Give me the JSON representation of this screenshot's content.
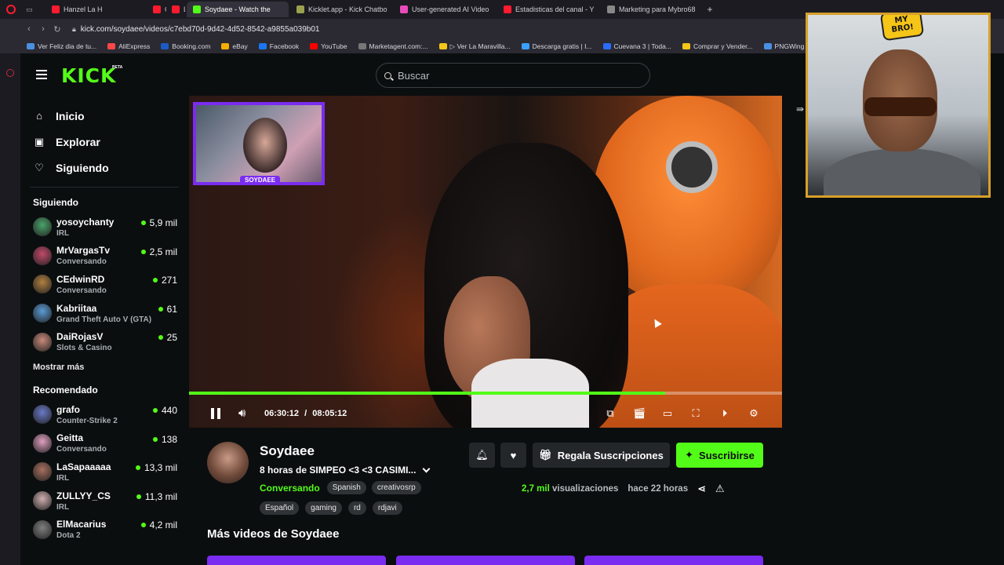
{
  "browser": {
    "tabs": [
      {
        "label": "Hanzel La H",
        "color": "#ff1b2d",
        "small": false
      },
      {
        "label": "Ovi",
        "color": "#ff1b2d",
        "small": true
      },
      {
        "label": "Lu",
        "color": "#ff1b2d",
        "small": true
      },
      {
        "label": "Soydaee - Watch the",
        "color": "#53fc18",
        "small": false,
        "active": true
      },
      {
        "label": "Kicklet.app - Kick Chatbo",
        "color": "#9aa14d",
        "small": false
      },
      {
        "label": "User-generated AI Video",
        "color": "#e74bb8",
        "small": false
      },
      {
        "label": "Estadisticas del canal - Y",
        "color": "#ff1b2d",
        "small": false
      },
      {
        "label": "Marketing para Mybro68",
        "color": "#888888",
        "small": false
      }
    ],
    "new_tab": "+",
    "url": "kick.com/soydaee/videos/c7ebd70d-9d42-4d52-8542-a9855a039b01",
    "bookmarks": [
      {
        "label": "Ver Feliz dia de tu...",
        "color": "#4a90e2"
      },
      {
        "label": "AliExpress",
        "color": "#ff4747"
      },
      {
        "label": "Booking.com",
        "color": "#1b5bc4"
      },
      {
        "label": "eBay",
        "color": "#f5af02"
      },
      {
        "label": "Facebook",
        "color": "#1877f2"
      },
      {
        "label": "YouTube",
        "color": "#ff0000"
      },
      {
        "label": "Marketagent.com:...",
        "color": "#777777"
      },
      {
        "label": "▷ Ver La Maravilla...",
        "color": "#f5c518"
      },
      {
        "label": "Descarga gratis | I...",
        "color": "#3aa0ff"
      },
      {
        "label": "Cuevana 3 | Toda...",
        "color": "#2b6cff"
      },
      {
        "label": "Comprar y Vender...",
        "color": "#f5c518"
      },
      {
        "label": "PNGWing - ima",
        "color": "#4a90e2"
      }
    ]
  },
  "header": {
    "logo": "KICK",
    "beta": "BETA",
    "search_placeholder": "Buscar"
  },
  "sidebar": {
    "nav": [
      {
        "label": "Inicio",
        "icon": "home-icon",
        "glyph": "⌂"
      },
      {
        "label": "Explorar",
        "icon": "explore-icon",
        "glyph": "▣"
      },
      {
        "label": "Siguiendo",
        "icon": "heart-icon",
        "glyph": "♡"
      }
    ],
    "following_title": "Siguiendo",
    "following": [
      {
        "name": "yosoychanty",
        "category": "IRL",
        "viewers": "5,9 mil",
        "avatar": "#4aa36a"
      },
      {
        "name": "MrVargasTv",
        "category": "Conversando",
        "viewers": "2,5 mil",
        "avatar": "#c24a6a"
      },
      {
        "name": "CEdwinRD",
        "category": "Conversando",
        "viewers": "271",
        "avatar": "#b08040"
      },
      {
        "name": "Kabriitaa",
        "category": "Grand Theft Auto V (GTA)",
        "viewers": "61",
        "avatar": "#5a9bd5"
      },
      {
        "name": "DaiRojasV",
        "category": "Slots & Casino",
        "viewers": "25",
        "avatar": "#c98a7a"
      }
    ],
    "show_more": "Mostrar más",
    "recommended_title": "Recomendado",
    "recommended": [
      {
        "name": "grafo",
        "category": "Counter-Strike 2",
        "viewers": "440",
        "avatar": "#6a7ac8"
      },
      {
        "name": "Geitta",
        "category": "Conversando",
        "viewers": "138",
        "avatar": "#e0a0c0"
      },
      {
        "name": "LaSapaaaaa",
        "category": "IRL",
        "viewers": "13,3 mil",
        "avatar": "#a87060"
      },
      {
        "name": "ZULLYY_CS",
        "category": "IRL",
        "viewers": "11,3 mil",
        "avatar": "#d0b0b0"
      },
      {
        "name": "ElMacarius",
        "category": "Dota 2",
        "viewers": "4,2 mil",
        "avatar": "#808080"
      }
    ]
  },
  "player": {
    "pip_label": "SOYDAEE",
    "current_time": "06:30:12",
    "separator": "/",
    "duration": "08:05:12",
    "progress": 0.803
  },
  "video_info": {
    "channel": "Soydaee",
    "title": "8 horas de SIMPEO  <3 <3 CASIMI...",
    "category": "Conversando",
    "tags_row1": [
      "Spanish",
      "creativosrp"
    ],
    "tags_row2": [
      "Español",
      "gaming",
      "rd",
      "rdjavi"
    ],
    "gift_label": "Regala Suscripciones",
    "subscribe_label": "Suscribirse",
    "views_count": "2,7 mil",
    "views_word": "visualizaciones",
    "age": "hace 22 horas",
    "more_videos_title": "Más videos de Soydaee"
  },
  "webcam": {
    "badge": "MY BRO!"
  },
  "colors": {
    "accent": "#53fc18",
    "background": "#0b0e0f",
    "pip_border": "#7a2cf0",
    "webcam_border": "#d6a02a"
  }
}
